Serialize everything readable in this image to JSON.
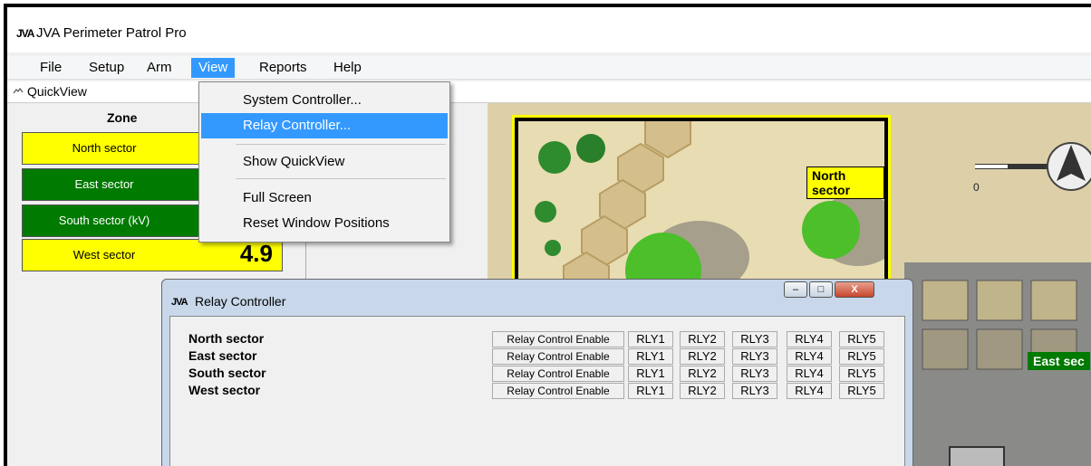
{
  "window": {
    "logo_text": "JVA",
    "title": "JVA Perimeter Patrol Pro"
  },
  "menu": {
    "items": [
      "File",
      "Setup",
      "Arm",
      "View",
      "Reports",
      "Help"
    ],
    "active": "View"
  },
  "view_menu": {
    "items": [
      {
        "label": "System Controller..."
      },
      {
        "label": "Relay Controller..."
      },
      {
        "label": "Show QuickView"
      },
      {
        "label": "Full Screen"
      },
      {
        "label": "Reset Window Positions"
      }
    ],
    "highlighted": "Relay Controller..."
  },
  "quickview": {
    "icon": "chevron-up-icon",
    "label": "QuickView",
    "zone_header": "Zone",
    "zones": [
      {
        "name": "North sector",
        "value": "",
        "color": "#ffff00"
      },
      {
        "name": "East sector",
        "value": "",
        "color": "#007a00"
      },
      {
        "name": "South sector  (kV)",
        "value": "",
        "color": "#007a00"
      },
      {
        "name": "West sector",
        "value": "4.9",
        "color": "#ffff00"
      }
    ]
  },
  "map": {
    "north_label": "North sector",
    "east_label": "East sec",
    "compass_scale_label": "0"
  },
  "relay_window": {
    "logo_text": "JVA",
    "title": "Relay Controller",
    "enable_label": "Relay Control Enable",
    "relays": [
      "RLY1",
      "RLY2",
      "RLY3",
      "RLY4",
      "RLY5"
    ],
    "rows": [
      {
        "label": "North sector"
      },
      {
        "label": "East sector"
      },
      {
        "label": "South sector"
      },
      {
        "label": "West sector"
      }
    ],
    "controls": {
      "minimize": "‒",
      "maximize": "□",
      "close": "X"
    }
  },
  "colors": {
    "menu_highlight": "#3399ff",
    "zone_yellow": "#ffff00",
    "zone_green": "#007a00"
  }
}
